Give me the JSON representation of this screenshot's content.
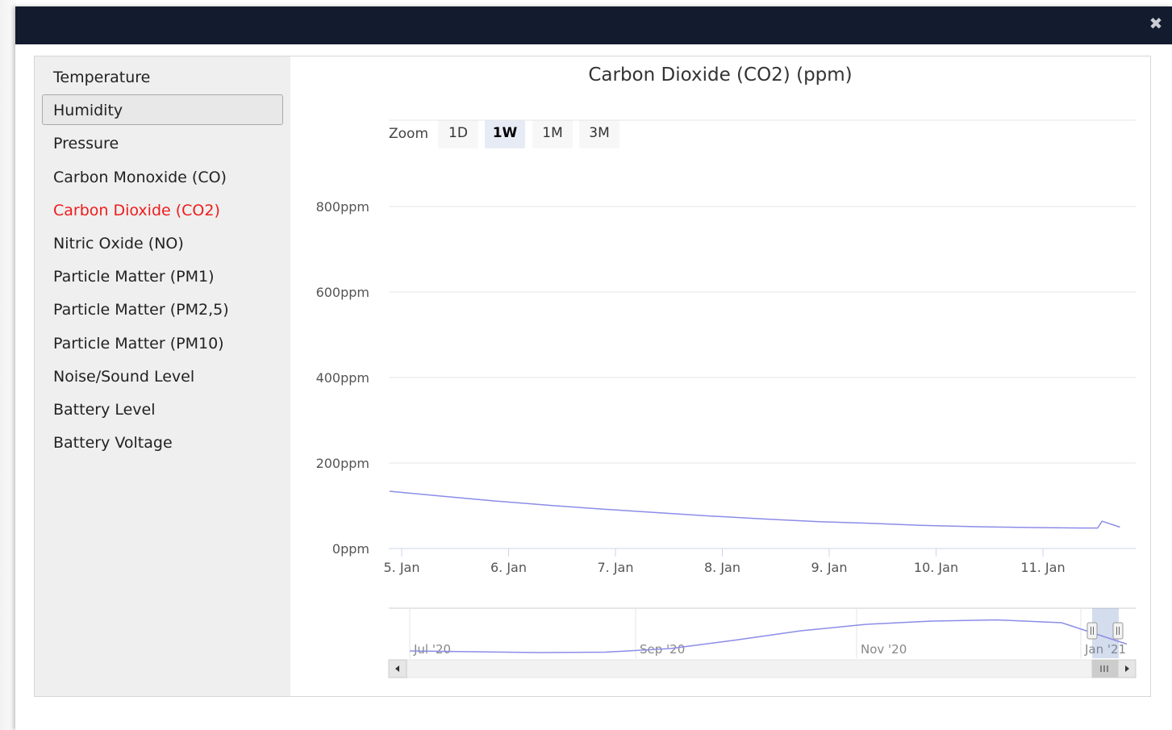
{
  "modal": {
    "close_icon": "times-icon",
    "close_glyph": "✖"
  },
  "sidebar": {
    "items": [
      {
        "label": "Temperature"
      },
      {
        "label": "Humidity"
      },
      {
        "label": "Pressure"
      },
      {
        "label": "Carbon Monoxide (CO)"
      },
      {
        "label": "Carbon Dioxide (CO2)"
      },
      {
        "label": "Nitric Oxide (NO)"
      },
      {
        "label": "Particle Matter (PM1)"
      },
      {
        "label": "Particle Matter (PM2,5)"
      },
      {
        "label": "Particle Matter (PM10)"
      },
      {
        "label": "Noise/Sound Level"
      },
      {
        "label": "Battery Level"
      },
      {
        "label": "Battery Voltage"
      }
    ],
    "hovered_index": 1,
    "active_index": 4,
    "active_color": "#ee1c1c"
  },
  "zoom": {
    "label": "Zoom",
    "buttons": [
      "1D",
      "1W",
      "1M",
      "3M"
    ],
    "selected": "1W"
  },
  "chart_data": {
    "type": "line",
    "title": "Carbon Dioxide (CO2) (ppm)",
    "ylim": [
      0,
      800
    ],
    "y_ticks": [
      "0ppm",
      "200ppm",
      "400ppm",
      "600ppm",
      "800ppm"
    ],
    "x_ticks": [
      "5. Jan",
      "6. Jan",
      "7. Jan",
      "8. Jan",
      "9. Jan",
      "10. Jan",
      "11. Jan"
    ],
    "series": [
      {
        "color": "#8c8ce8",
        "x": [
          "5. Jan 00:00",
          "5. Jan 12:00",
          "6. Jan 00:00",
          "6. Jan 12:00",
          "7. Jan 00:00",
          "7. Jan 12:00",
          "8. Jan 00:00",
          "8. Jan 12:00",
          "9. Jan 00:00",
          "9. Jan 12:00",
          "10. Jan 00:00",
          "10. Jan 12:00",
          "11. Jan 00:00",
          "11. Jan 12:00",
          "11. Jan 15:00",
          "11. Jan 16:00",
          "11. Jan 20:00"
        ],
        "values": [
          134,
          122,
          111,
          101,
          92,
          84,
          76,
          69,
          63,
          59,
          54,
          51,
          49,
          48,
          48,
          64,
          50
        ]
      }
    ],
    "navigator": {
      "x_ticks": [
        "Jul '20",
        "Sep '20",
        "Nov '20",
        "Jan '21"
      ],
      "series_values": [
        0.08,
        0.06,
        0.04,
        0.05,
        0.14,
        0.35,
        0.58,
        0.74,
        0.82,
        0.85,
        0.78,
        0.25
      ]
    }
  }
}
